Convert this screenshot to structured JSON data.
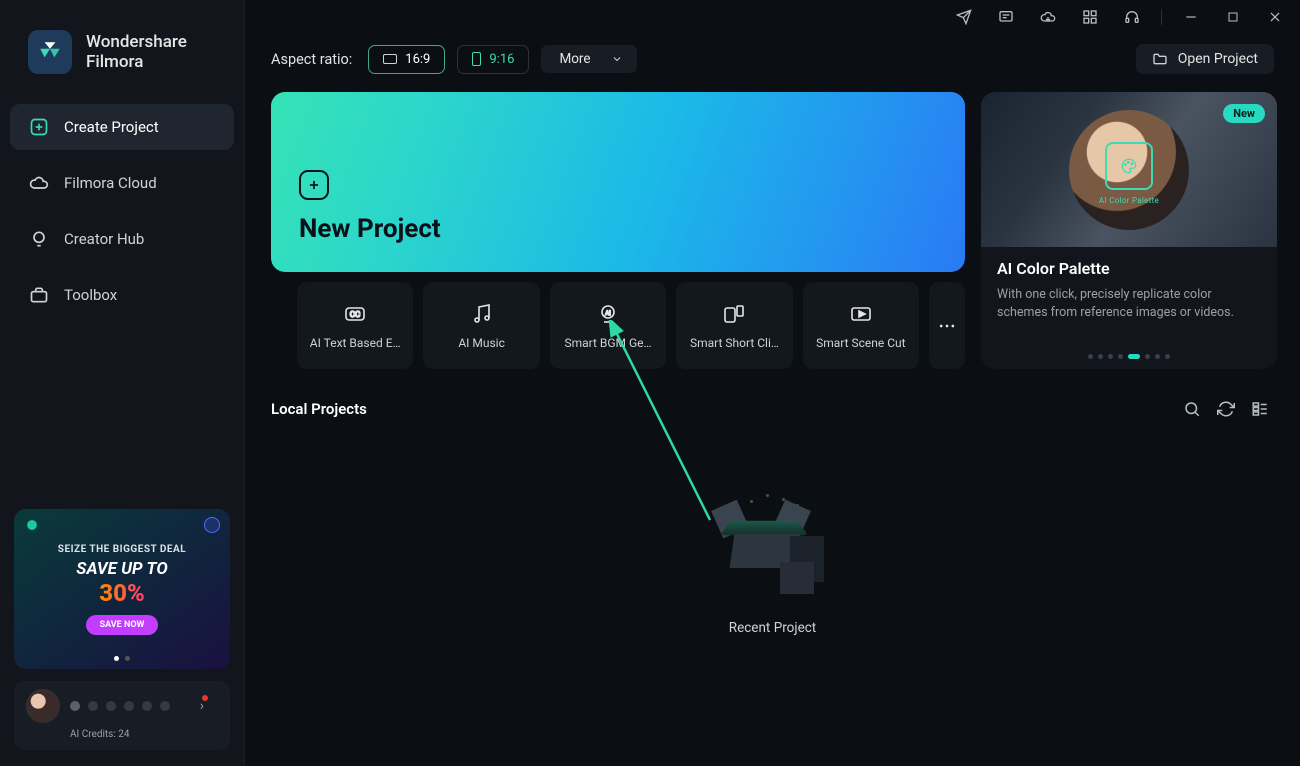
{
  "brand": {
    "line1": "Wondershare",
    "line2": "Filmora"
  },
  "nav": {
    "items": [
      {
        "label": "Create Project",
        "icon": "plus-square",
        "active": true
      },
      {
        "label": "Filmora Cloud",
        "icon": "cloud",
        "active": false
      },
      {
        "label": "Creator Hub",
        "icon": "lightbulb",
        "active": false
      },
      {
        "label": "Toolbox",
        "icon": "toolbox",
        "active": false
      }
    ]
  },
  "promo": {
    "line1": "SEIZE THE BIGGEST DEAL",
    "line2": "SAVE UP TO",
    "line3": "30%",
    "cta": "SAVE NOW"
  },
  "user": {
    "credits_label": "AI Credits: 24"
  },
  "toolbar": {
    "aspect_label": "Aspect ratio:",
    "ratios": [
      {
        "label": "16:9",
        "active": true
      },
      {
        "label": "9:16",
        "active": false
      }
    ],
    "more": "More",
    "open_project": "Open Project"
  },
  "new_project": {
    "label": "New Project"
  },
  "tools": [
    {
      "label": "AI Text Based E…"
    },
    {
      "label": "AI Music"
    },
    {
      "label": "Smart BGM Ge…"
    },
    {
      "label": "Smart Short Cli…"
    },
    {
      "label": "Smart Scene Cut"
    }
  ],
  "feature": {
    "badge": "New",
    "title": "AI Color Palette",
    "desc": "With one click, precisely replicate color schemes from reference images or videos.",
    "img_badge_label": "AI Color Palette",
    "active_dot_index": 4,
    "dot_count": 8
  },
  "local": {
    "heading": "Local Projects",
    "empty": "Recent Project"
  }
}
